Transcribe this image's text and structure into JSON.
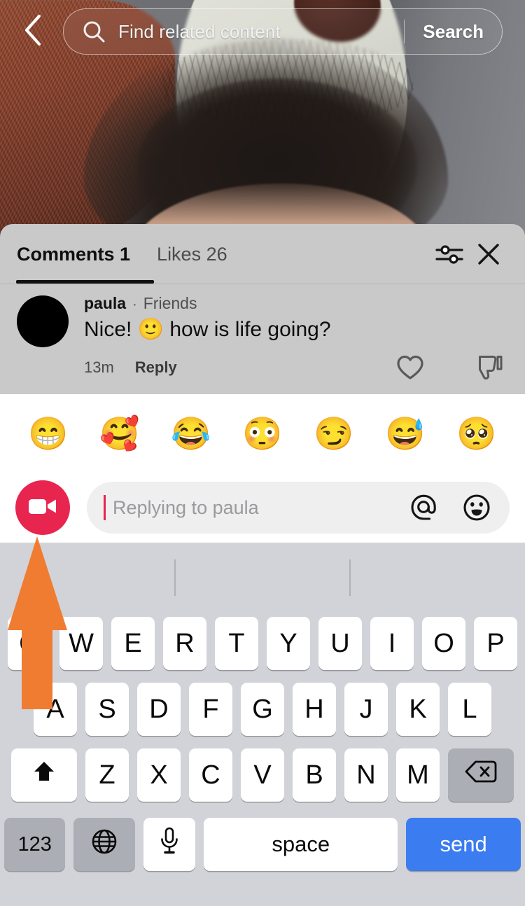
{
  "search": {
    "back_icon": "chevron-left-icon",
    "search_icon": "search-icon",
    "placeholder": "Find related content",
    "action_label": "Search"
  },
  "comments_panel": {
    "tabs": [
      {
        "label": "Comments 1",
        "active": true
      },
      {
        "label": "Likes 26",
        "active": false
      }
    ],
    "header_icons": [
      {
        "name": "filter-sliders-icon",
        "label": "Filter"
      },
      {
        "name": "close-icon",
        "label": "Close"
      }
    ],
    "comments": [
      {
        "author": "paula",
        "separator": "·",
        "relationship": "Friends",
        "text": "Nice! 🙂 how is life going?",
        "time": "13m",
        "reply_label": "Reply",
        "like_icon": "heart-outline-icon",
        "dislike_icon": "thumbs-down-outline-icon"
      }
    ]
  },
  "emoji_row": {
    "emojis": [
      {
        "name": "grinning-face-emoji",
        "glyph": "😁"
      },
      {
        "name": "smiling-face-with-hearts-emoji",
        "glyph": "🥰"
      },
      {
        "name": "face-with-tears-of-joy-emoji",
        "glyph": "😂"
      },
      {
        "name": "flushed-face-emoji",
        "glyph": "😳"
      },
      {
        "name": "smirking-face-emoji",
        "glyph": "😏"
      },
      {
        "name": "grinning-face-with-sweat-emoji",
        "glyph": "😅"
      },
      {
        "name": "pleading-face-emoji",
        "glyph": "🥺"
      }
    ]
  },
  "input_bar": {
    "video_icon": "video-camera-icon",
    "placeholder": "Replying to paula",
    "mention_icon": "at-sign-icon",
    "emoji_icon": "emoji-picker-icon",
    "accent_color": "#e8254f"
  },
  "keyboard": {
    "row1": [
      "Q",
      "W",
      "E",
      "R",
      "T",
      "Y",
      "U",
      "I",
      "O",
      "P"
    ],
    "row2": [
      "A",
      "S",
      "D",
      "F",
      "G",
      "H",
      "J",
      "K",
      "L"
    ],
    "row3_shift": "shift-up-arrow-icon",
    "row3": [
      "Z",
      "X",
      "C",
      "V",
      "B",
      "N",
      "M"
    ],
    "row3_backspace": "backspace-delete-icon",
    "row4": {
      "numbers_label": "123",
      "globe_icon": "globe-language-icon",
      "mic_icon": "microphone-icon",
      "space_label": "space",
      "send_label": "send",
      "send_color": "#3b7cf0"
    }
  },
  "annotation": {
    "arrow_color": "#f07c32",
    "points_to": "video-camera-button"
  }
}
